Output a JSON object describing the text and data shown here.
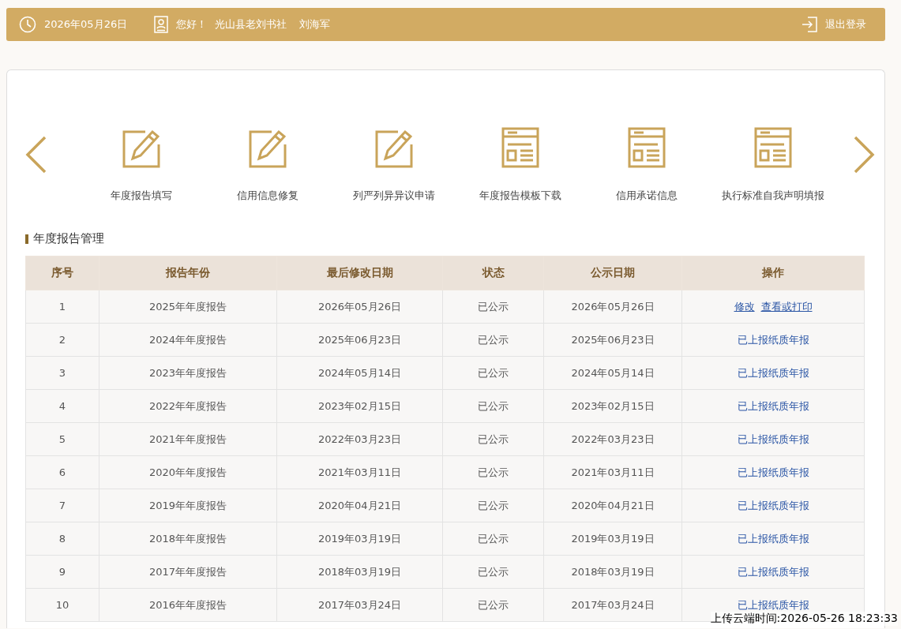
{
  "header": {
    "date": "2026年05月26日",
    "greeting": "您好！",
    "org": "光山县老刘书社",
    "user": "刘海军",
    "logout": "退出登录"
  },
  "shortcuts": [
    {
      "label": "年度报告填写",
      "kind": "edit"
    },
    {
      "label": "信用信息修复",
      "kind": "edit"
    },
    {
      "label": "列严列异异议申请",
      "kind": "edit"
    },
    {
      "label": "年度报告模板下载",
      "kind": "form"
    },
    {
      "label": "信用承诺信息",
      "kind": "form"
    },
    {
      "label": "执行标准自我声明填报",
      "kind": "form"
    }
  ],
  "section_title": "年度报告管理",
  "table": {
    "columns": [
      "序号",
      "报告年份",
      "最后修改日期",
      "状态",
      "公示日期",
      "操作"
    ],
    "rows": [
      {
        "cells": [
          "1",
          "2025年年度报告",
          "2026年05月26日",
          "已公示",
          "2026年05月26日"
        ],
        "actions": [
          {
            "label": "修改",
            "kind": "underlined"
          },
          {
            "label": "查看或打印",
            "kind": "underlined"
          }
        ]
      },
      {
        "cells": [
          "2",
          "2024年年度报告",
          "2025年06月23日",
          "已公示",
          "2025年06月23日"
        ],
        "actions": [
          {
            "label": "已上报纸质年报",
            "kind": "plain"
          }
        ]
      },
      {
        "cells": [
          "3",
          "2023年年度报告",
          "2024年05月14日",
          "已公示",
          "2024年05月14日"
        ],
        "actions": [
          {
            "label": "已上报纸质年报",
            "kind": "plain"
          }
        ]
      },
      {
        "cells": [
          "4",
          "2022年年度报告",
          "2023年02月15日",
          "已公示",
          "2023年02月15日"
        ],
        "actions": [
          {
            "label": "已上报纸质年报",
            "kind": "plain"
          }
        ]
      },
      {
        "cells": [
          "5",
          "2021年年度报告",
          "2022年03月23日",
          "已公示",
          "2022年03月23日"
        ],
        "actions": [
          {
            "label": "已上报纸质年报",
            "kind": "plain"
          }
        ]
      },
      {
        "cells": [
          "6",
          "2020年年度报告",
          "2021年03月11日",
          "已公示",
          "2021年03月11日"
        ],
        "actions": [
          {
            "label": "已上报纸质年报",
            "kind": "plain"
          }
        ]
      },
      {
        "cells": [
          "7",
          "2019年年度报告",
          "2020年04月21日",
          "已公示",
          "2020年04月21日"
        ],
        "actions": [
          {
            "label": "已上报纸质年报",
            "kind": "plain"
          }
        ]
      },
      {
        "cells": [
          "8",
          "2018年年度报告",
          "2019年03月19日",
          "已公示",
          "2019年03月19日"
        ],
        "actions": [
          {
            "label": "已上报纸质年报",
            "kind": "plain"
          }
        ]
      },
      {
        "cells": [
          "9",
          "2017年年度报告",
          "2018年03月19日",
          "已公示",
          "2018年03月19日"
        ],
        "actions": [
          {
            "label": "已上报纸质年报",
            "kind": "plain"
          }
        ]
      },
      {
        "cells": [
          "10",
          "2016年年度报告",
          "2017年03月24日",
          "已公示",
          "2017年03月24日"
        ],
        "actions": [
          {
            "label": "已上报纸质年报",
            "kind": "plain"
          }
        ]
      }
    ]
  },
  "upload_time": "上传云端时间:2026-05-26 18:23:33"
}
